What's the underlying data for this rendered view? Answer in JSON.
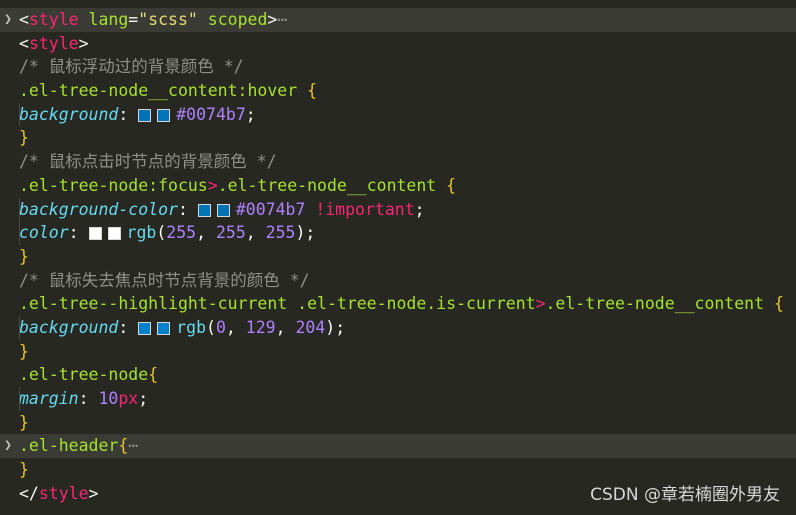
{
  "editor": {
    "lines": [
      {
        "kind": "style-open-folded",
        "tag_open": "<",
        "tag_name": "style",
        "attr1": "lang",
        "eq1": "=",
        "val1": "\"scss\"",
        "attr2": "scoped",
        "tag_close": ">",
        "ellipsis": "⋯"
      },
      {
        "kind": "tag",
        "text_open": "<",
        "tag_name": "style",
        "text_close": ">"
      },
      {
        "kind": "comment",
        "text": "/* 鼠标浮动过的背景颜色 */"
      },
      {
        "kind": "selector",
        "selector": ".el-tree-node__content:hover",
        "brace": "{"
      },
      {
        "kind": "decl",
        "prop": "background",
        "colon": ":",
        "swatch": "#0074b7",
        "value": "#0074b7",
        "semi": ";"
      },
      {
        "kind": "close",
        "brace": "}"
      },
      {
        "kind": "comment",
        "text": "/* 鼠标点击时节点的背景颜色 */"
      },
      {
        "kind": "selector2",
        "sel_a": ".el-tree-node:focus",
        "gt": ">",
        "sel_b": ".el-tree-node__content",
        "brace": "{"
      },
      {
        "kind": "decl-important",
        "prop": "background-color",
        "colon": ":",
        "swatch": "#0074b7",
        "value": "#0074b7",
        "important": "!important",
        "semi": ";"
      },
      {
        "kind": "decl-rgb",
        "prop": "color",
        "colon": ":",
        "swatch": "#ffffff",
        "fn": "rgb",
        "args": [
          "255",
          "255",
          "255"
        ],
        "semi": ";"
      },
      {
        "kind": "close",
        "brace": "}"
      },
      {
        "kind": "comment",
        "text": "/* 鼠标失去焦点时节点背景的颜色 */"
      },
      {
        "kind": "selector2",
        "sel_a": ".el-tree--highlight-current .el-tree-node.is-current",
        "gt": ">",
        "sel_b": ".el-tree-node__content",
        "brace": "{"
      },
      {
        "kind": "decl-rgb",
        "prop": "background",
        "colon": ":",
        "swatch": "#0081cc",
        "fn": "rgb",
        "args": [
          "0",
          "129",
          "204"
        ],
        "semi": ";"
      },
      {
        "kind": "close",
        "brace": "}"
      },
      {
        "kind": "selector-tight",
        "selector": ".el-tree-node",
        "brace": "{"
      },
      {
        "kind": "decl-px",
        "prop": "margin",
        "colon": ":",
        "num": "10",
        "unit": "px",
        "semi": ";"
      },
      {
        "kind": "close",
        "brace": "}"
      },
      {
        "kind": "selector-folded",
        "selector": ".el-header",
        "brace": "{",
        "ellipsis": "⋯"
      },
      {
        "kind": "close",
        "brace": "}"
      },
      {
        "kind": "tag-close",
        "text_open": "</",
        "tag_name": "style",
        "text_close": ">"
      }
    ]
  },
  "colors": {
    "background": "#272822",
    "fold_highlight": "#3a3b35"
  },
  "icons": {
    "fold": "chevron-right-icon"
  },
  "watermark": {
    "text": "CSDN @章若楠圈外男友"
  }
}
